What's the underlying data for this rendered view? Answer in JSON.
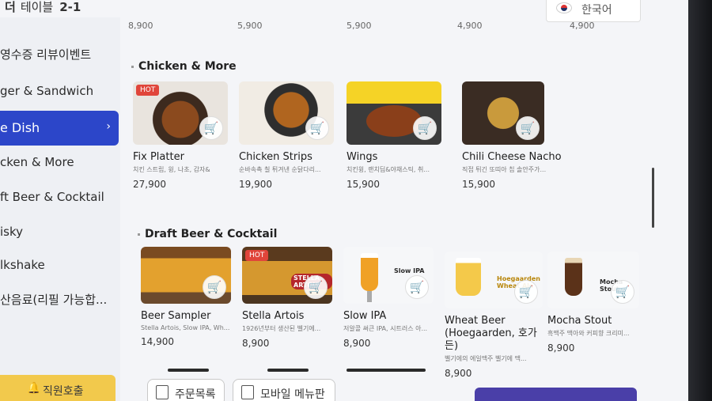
{
  "topbar": {
    "table_prefix": "테이블",
    "table_number": "2-1",
    "language": "한국어"
  },
  "sidebar": {
    "items": [
      {
        "label": "영수증 리뷰이벤트",
        "active": false
      },
      {
        "label": "ger & Sandwich",
        "active": false
      },
      {
        "label": "e Dish",
        "active": true
      },
      {
        "label": "cken & More",
        "active": false
      },
      {
        "label": "ft Beer & Cocktail",
        "active": false
      },
      {
        "label": "isky",
        "active": false
      },
      {
        "label": "lkshake",
        "active": false
      },
      {
        "label": "산음료(리필 가능합...",
        "active": false
      }
    ],
    "staff_call": "직원호출"
  },
  "prev_prices": [
    "8,900",
    "5,900",
    "5,900",
    "4,900",
    "4,900"
  ],
  "sections": {
    "chicken": {
      "title": "Chicken & More",
      "items": [
        {
          "name": "Fix Platter",
          "desc": "치킨 스트립, 윙, 나초, 감자&",
          "price": "27,900",
          "hot": true,
          "hot_label": "HOT"
        },
        {
          "name": "Chicken Strips",
          "desc": "순바속촉 칠 튀겨낸 순닭다리...",
          "price": "19,900",
          "hot": false
        },
        {
          "name": "Wings",
          "desc": "치킨윙, 랜치딥&야채스틱, 취...",
          "price": "15,900",
          "hot": false
        },
        {
          "name": "Chili Cheese Nacho",
          "desc": "직접 튀긴 또띠아 칩 솔안주가...",
          "price": "15,900",
          "hot": false
        }
      ]
    },
    "beer": {
      "title": "Draft Beer & Cocktail",
      "items": [
        {
          "name": "Beer Sampler",
          "desc": "Stella Artois, Slow IPA, Wh...",
          "price": "14,900",
          "hot": false,
          "tag": ""
        },
        {
          "name": "Stella Artois",
          "desc": "1926년부터 생산된 벨기에...",
          "price": "8,900",
          "hot": true,
          "hot_label": "HOT",
          "tag": "STELLA ARTOIS"
        },
        {
          "name": "Slow IPA",
          "desc": "저알콜 써큰 IPA, 시트러스 아...",
          "price": "8,900",
          "hot": false,
          "tag": "Slow IPA"
        },
        {
          "name": "Wheat Beer (Hoegaarden, 호가든)",
          "desc": "벨기에의 에일맥주 벨기에 맥...",
          "price": "8,900",
          "hot": false,
          "tag": "Hoegaarden Wheat Ale"
        },
        {
          "name": "Mocha Stout",
          "desc": "흑맥주 맥아와 커피향 크리미...",
          "price": "8,900",
          "hot": false,
          "tag": "Mocha Stout"
        }
      ]
    }
  },
  "bottom": {
    "order_list": "주문목록",
    "mobile_menu": "모바일 메뉴판"
  },
  "colors": {
    "accent": "#2c46c9",
    "hot": "#e0453a",
    "staff": "#f2c94c",
    "pay": "#4a3fa8"
  }
}
